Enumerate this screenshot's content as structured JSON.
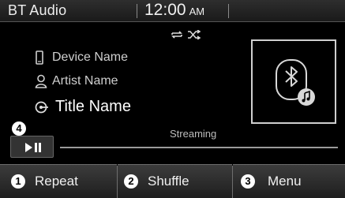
{
  "header": {
    "source": "BT Audio",
    "time": "12:00",
    "ampm": "AM"
  },
  "mode_icons": [
    "repeat-icon",
    "shuffle-icon"
  ],
  "track": {
    "device": "Device Name",
    "artist": "Artist Name",
    "title": "Title Name",
    "status": "Streaming"
  },
  "playback": {
    "callout": "4",
    "progress": 0
  },
  "buttons": [
    {
      "num": "1",
      "label": "Repeat"
    },
    {
      "num": "2",
      "label": "Shuffle"
    },
    {
      "num": "3",
      "label": "Menu"
    }
  ],
  "colors": {
    "background": "#000000",
    "bar": "#2e2e2e",
    "button": "#2c2c2c",
    "text": "#e6e6e6"
  }
}
